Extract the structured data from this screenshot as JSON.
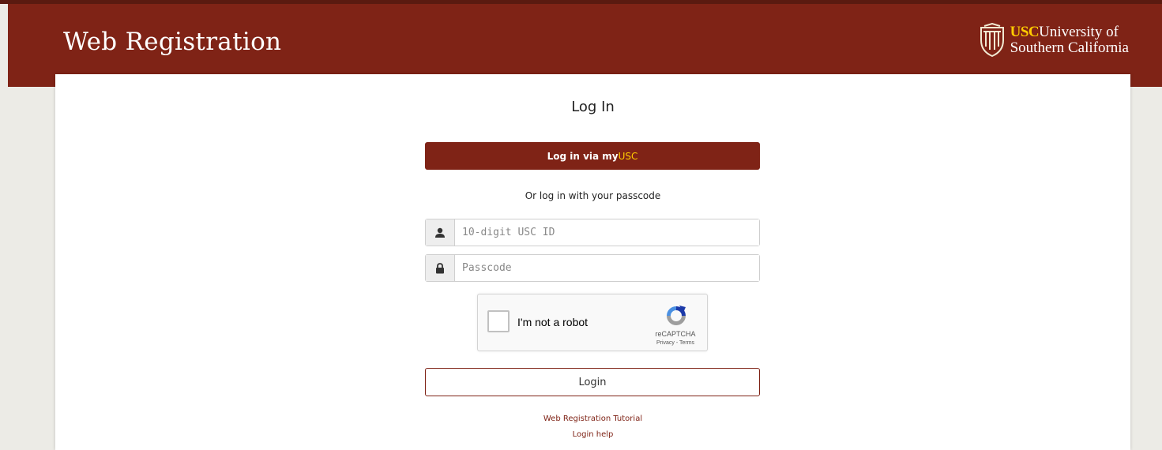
{
  "header": {
    "title": "Web Registration",
    "logo": {
      "abbr": "USC",
      "line1_suffix": "University of",
      "line2": "Southern California"
    }
  },
  "login": {
    "heading": "Log In",
    "myusc_button": {
      "prefix": "Log in via ",
      "my": "my",
      "usc": "USC"
    },
    "or_text": "Or log in with your passcode",
    "id_field": {
      "placeholder": "10-digit USC ID",
      "value": "",
      "icon": "user-icon"
    },
    "passcode_field": {
      "placeholder": "Passcode",
      "value": "",
      "icon": "lock-icon"
    },
    "recaptcha": {
      "label": "I'm not a robot",
      "brand": "reCAPTCHA",
      "links": "Privacy - Terms",
      "checked": false
    },
    "login_button": "Login",
    "links": {
      "tutorial": "Web Registration Tutorial",
      "help": "Login help"
    }
  },
  "colors": {
    "brand_cardinal": "#7f2316",
    "brand_gold": "#ffcc00",
    "page_background": "#ecebe6"
  }
}
